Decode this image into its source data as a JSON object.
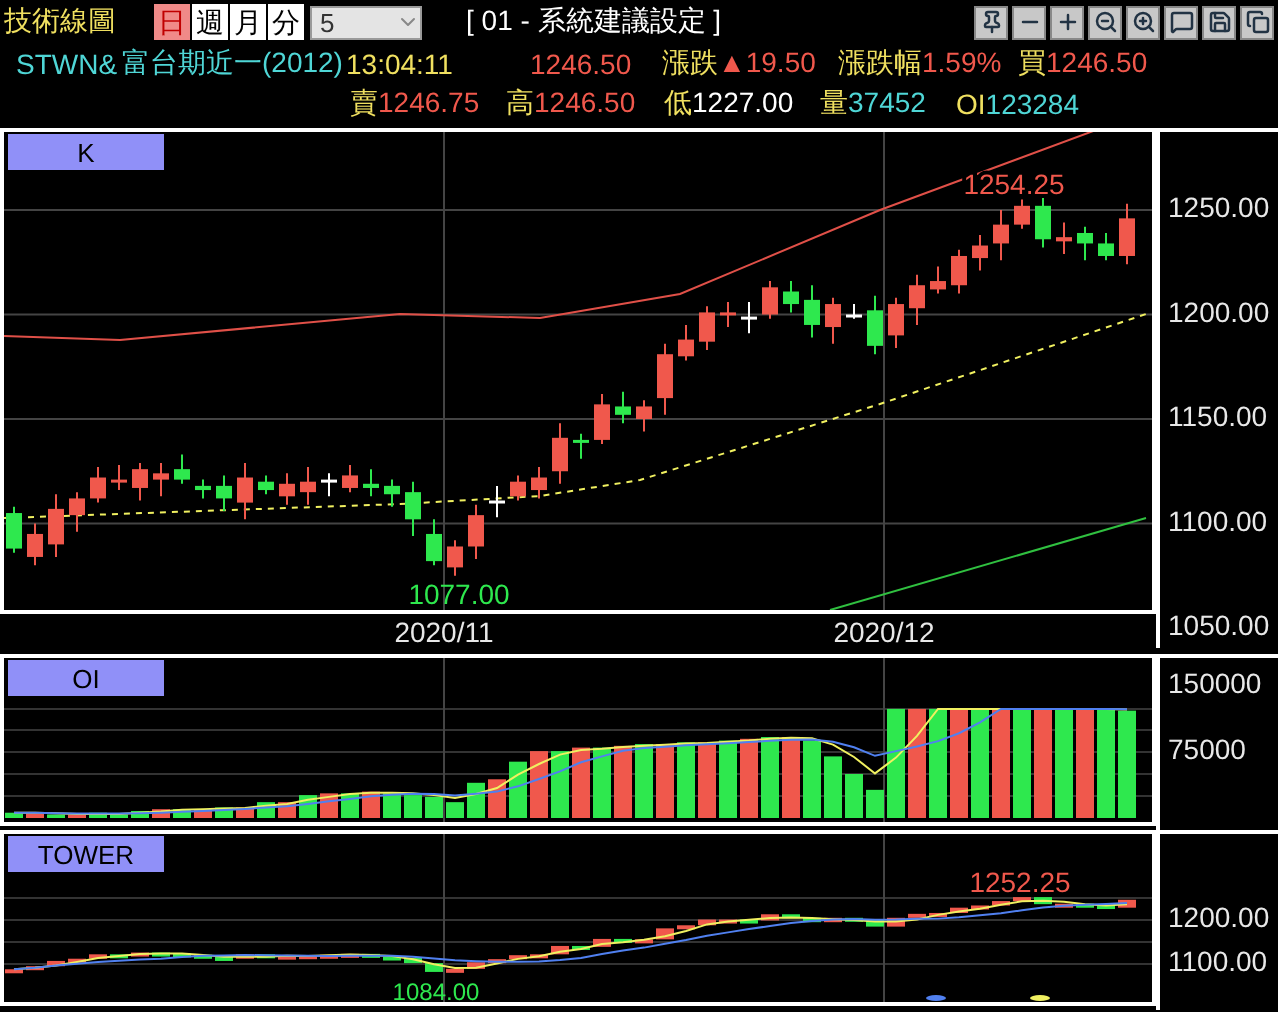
{
  "title": "技術線圖",
  "periods": [
    {
      "label": "日",
      "selected": true
    },
    {
      "label": "週",
      "selected": false
    },
    {
      "label": "月",
      "selected": false
    },
    {
      "label": "分",
      "selected": false
    }
  ],
  "interval_select": {
    "value": "5"
  },
  "layout_label": "[ 01 - 系統建議設定 ]",
  "quote": {
    "symbol": "STWN&",
    "name": "富台期近一(2012)",
    "time": "13:04:11",
    "price": "1246.50",
    "fields_row_1": [
      {
        "label": "漲跌",
        "value": "▲19.50",
        "color": "#f0584c"
      },
      {
        "label": "漲跌幅",
        "value": "1.59%",
        "color": "#f0584c"
      },
      {
        "label": "買",
        "value": "1246.50",
        "color": "#f0584c"
      }
    ],
    "fields_row_2": [
      {
        "label": "賣",
        "value": "1246.75",
        "color": "#f0584c"
      },
      {
        "label": "高",
        "value": "1246.50",
        "color": "#f0584c"
      },
      {
        "label": "低",
        "value": "1227.00",
        "color": "#ffffff"
      },
      {
        "label": "量",
        "value": "37452",
        "color": "#4fd6d6"
      },
      {
        "label": "OI",
        "value": "123284",
        "color": "#4fd6d6"
      }
    ]
  },
  "panels": [
    {
      "kind": "candlestick",
      "label": "K",
      "y_axis": [
        "1250.00",
        "1200.00",
        "1150.00",
        "1100.00",
        "1050.00"
      ],
      "x_axis": [
        "2020/11",
        "2020/12"
      ],
      "high_marker": "1254.25",
      "low_marker": "1077.00"
    },
    {
      "kind": "open_interest",
      "label": "OI",
      "y_axis": [
        "150000",
        "75000"
      ]
    },
    {
      "kind": "tower",
      "label": "TOWER",
      "y_axis": [
        "1200.00",
        "1100.00"
      ],
      "high_marker": "1252.25",
      "low_marker": "1084.00"
    }
  ]
}
